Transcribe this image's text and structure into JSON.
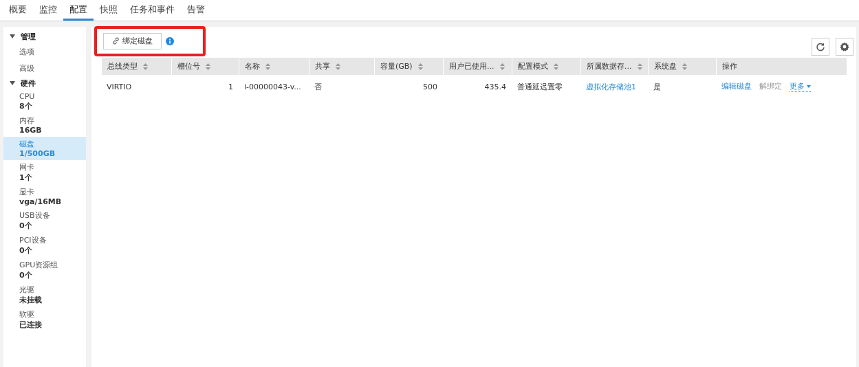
{
  "tabs": [
    {
      "label": "概要",
      "selected": false
    },
    {
      "label": "监控",
      "selected": false
    },
    {
      "label": "配置",
      "selected": true
    },
    {
      "label": "快照",
      "selected": false
    },
    {
      "label": "任务和事件",
      "selected": false
    },
    {
      "label": "告警",
      "selected": false
    }
  ],
  "sidebar": {
    "groups": [
      {
        "label": "管理",
        "expanded": true,
        "children": [
          {
            "label": "选项",
            "selected": false
          },
          {
            "label": "高级",
            "selected": false
          }
        ]
      },
      {
        "label": "硬件",
        "expanded": true,
        "children": [
          {
            "label": "CPU",
            "value": "8个",
            "selected": false
          },
          {
            "label": "内存",
            "value": "16GB",
            "selected": false
          },
          {
            "label": "磁盘",
            "value": "1/500GB",
            "selected": true
          },
          {
            "label": "网卡",
            "value": "1个",
            "selected": false
          },
          {
            "label": "显卡",
            "value": "vga/16MB",
            "selected": false
          },
          {
            "label": "USB设备",
            "value": "0个",
            "selected": false
          },
          {
            "label": "PCI设备",
            "value": "0个",
            "selected": false
          },
          {
            "label": "GPU资源组",
            "value": "0个",
            "selected": false
          },
          {
            "label": "光驱",
            "value": "未挂载",
            "selected": false
          },
          {
            "label": "软驱",
            "value": "已连接",
            "selected": false
          }
        ]
      }
    ]
  },
  "toolbar": {
    "bind_button": "绑定磁盘",
    "highlighted": true
  },
  "table": {
    "columns": [
      {
        "label": "总线类型",
        "sortable": true
      },
      {
        "label": "槽位号",
        "sortable": true
      },
      {
        "label": "名称",
        "sortable": true
      },
      {
        "label": "共享",
        "sortable": true
      },
      {
        "label": "容量(GB)",
        "sortable": true
      },
      {
        "label": "用户已使用...",
        "sortable": true
      },
      {
        "label": "配置模式",
        "sortable": true
      },
      {
        "label": "所属数据存...",
        "sortable": true
      },
      {
        "label": "系统盘",
        "sortable": true
      },
      {
        "label": "操作",
        "sortable": false
      }
    ],
    "rows": [
      {
        "cells": [
          {
            "kind": "text",
            "text": "VIRTIO"
          },
          {
            "kind": "number",
            "text": "1"
          },
          {
            "kind": "text",
            "text": "i-00000043-v..."
          },
          {
            "kind": "text",
            "text": "否"
          },
          {
            "kind": "number",
            "text": "500"
          },
          {
            "kind": "number",
            "text": "435.4"
          },
          {
            "kind": "text",
            "text": "普通延迟置零"
          },
          {
            "kind": "link",
            "text": "虚拟化存储池1"
          },
          {
            "kind": "text",
            "text": "是"
          },
          {
            "kind": "actions",
            "actions": [
              {
                "kind": "link",
                "label": "编辑磁盘",
                "disabled": false
              },
              {
                "kind": "link",
                "label": "解绑定",
                "disabled": true
              },
              {
                "kind": "dropdown",
                "label": "更多",
                "disabled": false
              }
            ]
          }
        ]
      }
    ]
  }
}
